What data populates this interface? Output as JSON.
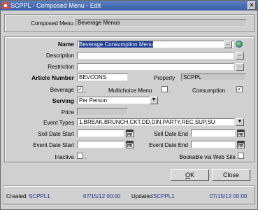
{
  "window": {
    "title": "SCPPL - Composed Menu - Edit"
  },
  "header": {
    "composed_menu_label": "Composed Menu",
    "composed_menu_value": "Beverage Menus"
  },
  "form": {
    "name_label": "Name",
    "name_value": "Beverage Consumption Menu",
    "description_label": "Description",
    "description_value": "",
    "restriction_label": "Restriction",
    "restriction_value": "",
    "article_number_label": "Article Number",
    "article_number_value": "BEVCONS",
    "property_label": "Property",
    "property_value": "SCPPL",
    "beverage_label": "Beverage",
    "multichoice_label": "Multichoice Menu",
    "consumption_label": "Consumption",
    "serving_label": "Serving",
    "serving_value": "Per Person",
    "price_label": "Price",
    "price_value": "",
    "event_types_label": "Event Types",
    "event_types_value": "1,BREAK,BRUNCH,CKT,DD,DIN,PARTY,REC,SUP,SU",
    "sell_date_start_label": "Sell Date Start",
    "sell_date_end_label": "Sell Date End",
    "event_date_start_label": "Event Date Start",
    "event_date_end_label": "Event Date End",
    "inactive_label": "Inactive",
    "bookable_label": "Bookable via Web Site",
    "lookup_glyph": "...",
    "dropdown_glyph": "▼",
    "check_glyph": "✓",
    "checkbox_dot": "."
  },
  "checkboxes": {
    "beverage": true,
    "multichoice": false,
    "consumption": true,
    "inactive": false,
    "bookable": false
  },
  "buttons": {
    "ok_label": "OK",
    "ok_access": "O",
    "ok_rest": "K",
    "close_label": "Close"
  },
  "footer": {
    "created_label": "Created",
    "created_user": "SCPPL1",
    "created_date": "07/15/12 00:00",
    "updated_label": "Updated",
    "updated_user": "SCPPL1",
    "updated_date": "07/15/12 00:00"
  }
}
